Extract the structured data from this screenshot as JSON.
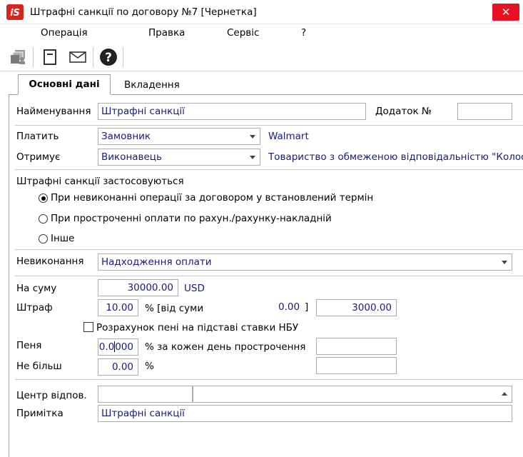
{
  "window": {
    "logo_text": "iS",
    "title": "Штрафні санкції по договору №7 [Чернетка]",
    "close_symbol": "✕"
  },
  "menu": [
    "Операція",
    "Правка",
    "Сервіс",
    "?"
  ],
  "toolbar": {
    "icons": [
      "folder-user-icon",
      "document-icon",
      "mail-icon",
      "help-icon"
    ]
  },
  "tabs": [
    {
      "label": "Основні дані",
      "active": true
    },
    {
      "label": "Вкладення",
      "active": false
    }
  ],
  "form": {
    "name_label": "Найменування",
    "name_value": "Штрафні санкції",
    "appendix_label": "Додаток №",
    "appendix_value": "",
    "payer_label": "Платить",
    "payer_value": "Замовник",
    "payer_org": "Walmart",
    "receiver_label": "Отримує",
    "receiver_value": "Виконавець",
    "receiver_org": "Товариство з обмеженою відповідальністю \"Колос",
    "applied_label": "Штрафні санкції застосовуються",
    "radios": [
      {
        "label": "При невиконанні операції за договором у встановлений термін",
        "checked": true
      },
      {
        "label": "При простроченні оплати по рахун./рахунку-накладній",
        "checked": false
      },
      {
        "label": "Інше",
        "checked": false
      }
    ],
    "nonperf_label": "Невиконання",
    "nonperf_value": "Надходження оплати",
    "sum_label": "На суму",
    "sum_value": "30000.00",
    "currency": "USD",
    "fine_label": "Штраф",
    "fine_value": "10.00",
    "fine_percent_text": "% [від суми",
    "fine_base_value": "0.00",
    "bracket_close": "]",
    "fine_result": "3000.00",
    "nbu_checkbox_label": "Розрахунок пені на підставі ставки НБУ",
    "nbu_checked": false,
    "penalty_label": "Пеня",
    "penalty_value_before_caret": "0.0",
    "penalty_value_after_caret": "000",
    "penalty_text": "% за кожен день прострочення",
    "penalty_result": "",
    "max_label": "Не більш",
    "max_value": "0.00",
    "max_percent": "%",
    "max_result": "",
    "center_label": "Центр відпов.",
    "center_code": "",
    "center_name": "",
    "note_label": "Примітка",
    "note_value": "Штрафні санкції"
  },
  "colors": {
    "close_button": "#e81123",
    "value_text": "#1a1a7a",
    "logo_red": "#d9261c"
  }
}
